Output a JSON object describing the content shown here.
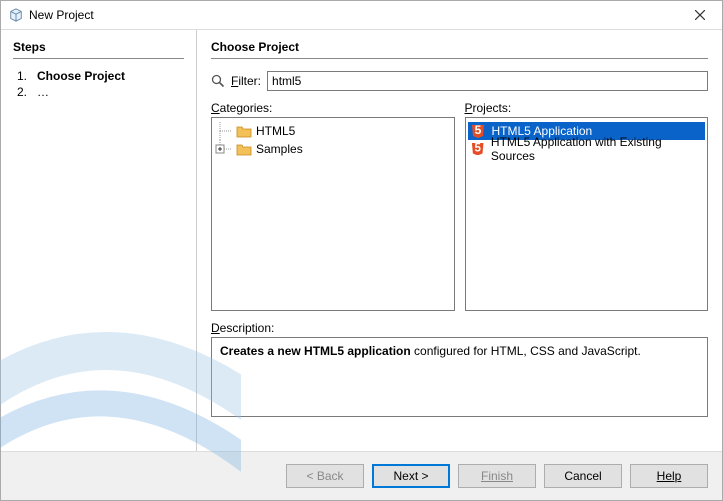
{
  "window": {
    "title": "New Project"
  },
  "steps": {
    "heading": "Steps",
    "items": [
      {
        "num": "1.",
        "label": "Choose Project",
        "current": true
      },
      {
        "num": "2.",
        "label": "…",
        "current": false
      }
    ]
  },
  "content": {
    "heading": "Choose Project",
    "filter": {
      "label_prefix": "F",
      "label_rest": "ilter:",
      "value": "html5"
    }
  },
  "categories": {
    "label_prefix": "C",
    "label_rest": "ategories:",
    "items": [
      {
        "label": "HTML5",
        "expandable": false
      },
      {
        "label": "Samples",
        "expandable": true
      }
    ]
  },
  "projects": {
    "label_prefix": "P",
    "label_rest": "rojects:",
    "items": [
      {
        "label": "HTML5 Application",
        "selected": true
      },
      {
        "label": "HTML5 Application with Existing Sources",
        "selected": false
      }
    ]
  },
  "description": {
    "label_prefix": "D",
    "label_rest": "escription:",
    "bold": "Creates a new HTML5 application",
    "rest": " configured for HTML, CSS and JavaScript."
  },
  "buttons": {
    "back": "< Back",
    "next": "Next >",
    "finish": "Finish",
    "cancel": "Cancel",
    "help": "Help"
  }
}
